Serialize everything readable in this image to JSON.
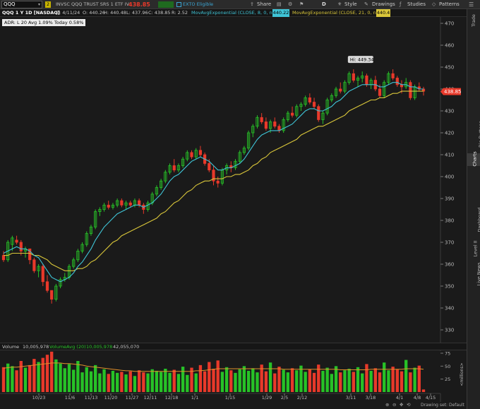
{
  "toolbar": {
    "symbol": "QQQ",
    "badge": "2",
    "security_name": "INVSC QQQ TRUST SRS 1 ETF IV",
    "last_price": "438.85",
    "change_pct": "",
    "ext_label": "EXTO Eligible",
    "share": "Share",
    "d_label": "D",
    "style": "Style",
    "drawings": "Drawings",
    "studies": "Studies",
    "patterns": "Patterns"
  },
  "infobar": {
    "title": "QQQ 1 Y 1D [NASDAQ]",
    "date": "D: 4/11/24",
    "open": "O: 440.26",
    "high": "H: 440.48",
    "low": "L: 437.96",
    "close": "C: 438.85",
    "range": "R: 2.52",
    "ma8_label": "MovAvgExponential (CLOSE, 8, 0, no)",
    "ma8_value": "440.22",
    "ma21_label": "MovAvgExponential (CLOSE, 21, 0, no)",
    "ma21_value": "440.4"
  },
  "adr": {
    "text": "ADR: L 20   Avg 1.09%   Today 0.58%"
  },
  "price_axis": {
    "ticks": [
      "470",
      "460",
      "450",
      "440",
      "430",
      "420",
      "410",
      "400",
      "390",
      "380",
      "370",
      "360",
      "350",
      "340",
      "330"
    ],
    "last_price_label": "438.85",
    "hi_label": "Hi: 449.34"
  },
  "volume": {
    "label": "Volume",
    "value": "10,005,978",
    "avg_label": "VolumeAvg (20)",
    "avg_value": "10,005,978",
    "third_value": "42,055,070",
    "axis_ticks": [
      "75",
      "50",
      "25"
    ],
    "axis_unit": "<millions>"
  },
  "date_axis": [
    "10/23",
    "11/6",
    "11/13",
    "11/20",
    "11/27",
    "12/11",
    "12/18",
    "1/1",
    "1/15",
    "1/29",
    "2/5",
    "2/12",
    "3/11",
    "3/18",
    "4/1",
    "4/8",
    "4/15"
  ],
  "sidebar": {
    "items": [
      "Trade",
      "Times And Sales",
      "Active Trader",
      "Big Buttons",
      "Charts",
      "Phase Scores",
      "Dashboard",
      "Level II",
      "Live News"
    ]
  },
  "bottom": {
    "drawing_set": "Drawing set: Default"
  },
  "colors": {
    "up": "#27c227",
    "down": "#e8392a",
    "ma8": "#3fc4d6",
    "ma21": "#d9c63a",
    "vol_avg": "#e0902a",
    "price_tag": "#e8392a"
  },
  "chart_data": {
    "type": "candlestick",
    "title": "QQQ 1 Y 1D [NASDAQ]",
    "ylim": [
      325,
      475
    ],
    "candles": [
      [
        364,
        366,
        361,
        362
      ],
      [
        362,
        371,
        361,
        370
      ],
      [
        369,
        373,
        366,
        372
      ],
      [
        371,
        373,
        369,
        370
      ],
      [
        370,
        371,
        364,
        366
      ],
      [
        366,
        368,
        363,
        367
      ],
      [
        367,
        367,
        360,
        362
      ],
      [
        362,
        363,
        356,
        357
      ],
      [
        357,
        360,
        354,
        359
      ],
      [
        359,
        360,
        350,
        352
      ],
      [
        352,
        355,
        347,
        348
      ],
      [
        348,
        348,
        342,
        344
      ],
      [
        344,
        351,
        343,
        350
      ],
      [
        350,
        354,
        349,
        353
      ],
      [
        353,
        356,
        352,
        354
      ],
      [
        354,
        360,
        353,
        359
      ],
      [
        359,
        363,
        358,
        362
      ],
      [
        362,
        367,
        361,
        366
      ],
      [
        366,
        370,
        365,
        369
      ],
      [
        369,
        375,
        368,
        374
      ],
      [
        374,
        378,
        373,
        377
      ],
      [
        377,
        385,
        376,
        384
      ],
      [
        384,
        386,
        382,
        385
      ],
      [
        385,
        388,
        384,
        387
      ],
      [
        387,
        389,
        385,
        386
      ],
      [
        386,
        388,
        385,
        387
      ],
      [
        387,
        390,
        386,
        389
      ],
      [
        389,
        390,
        386,
        387
      ],
      [
        387,
        389,
        385,
        388
      ],
      [
        388,
        389,
        386,
        387
      ],
      [
        387,
        390,
        386,
        389
      ],
      [
        389,
        390,
        386,
        387
      ],
      [
        387,
        388,
        383,
        385
      ],
      [
        385,
        389,
        384,
        388
      ],
      [
        388,
        393,
        387,
        392
      ],
      [
        392,
        396,
        391,
        395
      ],
      [
        395,
        399,
        394,
        398
      ],
      [
        398,
        403,
        397,
        402
      ],
      [
        402,
        406,
        401,
        405
      ],
      [
        405,
        408,
        402,
        403
      ],
      [
        403,
        406,
        402,
        405
      ],
      [
        405,
        409,
        404,
        408
      ],
      [
        408,
        412,
        407,
        411
      ],
      [
        411,
        412,
        408,
        409
      ],
      [
        409,
        413,
        408,
        412
      ],
      [
        412,
        414,
        409,
        410
      ],
      [
        410,
        411,
        405,
        406
      ],
      [
        406,
        408,
        402,
        403
      ],
      [
        403,
        405,
        396,
        398
      ],
      [
        398,
        400,
        395,
        397
      ],
      [
        397,
        404,
        396,
        403
      ],
      [
        403,
        406,
        401,
        405
      ],
      [
        405,
        407,
        402,
        404
      ],
      [
        404,
        408,
        403,
        407
      ],
      [
        407,
        412,
        406,
        411
      ],
      [
        411,
        414,
        410,
        413
      ],
      [
        413,
        421,
        412,
        420
      ],
      [
        420,
        424,
        418,
        423
      ],
      [
        423,
        428,
        422,
        427
      ],
      [
        427,
        429,
        424,
        425
      ],
      [
        425,
        427,
        421,
        422
      ],
      [
        422,
        426,
        420,
        425
      ],
      [
        425,
        427,
        422,
        423
      ],
      [
        423,
        424,
        420,
        421
      ],
      [
        421,
        427,
        420,
        426
      ],
      [
        426,
        430,
        425,
        429
      ],
      [
        429,
        432,
        427,
        428
      ],
      [
        428,
        433,
        427,
        432
      ],
      [
        432,
        434,
        430,
        433
      ],
      [
        433,
        437,
        432,
        436
      ],
      [
        436,
        438,
        433,
        434
      ],
      [
        434,
        436,
        431,
        432
      ],
      [
        432,
        433,
        425,
        426
      ],
      [
        426,
        430,
        424,
        429
      ],
      [
        429,
        436,
        428,
        435
      ],
      [
        435,
        438,
        434,
        437
      ],
      [
        437,
        441,
        436,
        440
      ],
      [
        440,
        443,
        438,
        439
      ],
      [
        439,
        444,
        438,
        443
      ],
      [
        443,
        448,
        442,
        447
      ],
      [
        447,
        449,
        443,
        444
      ],
      [
        444,
        446,
        441,
        445
      ],
      [
        445,
        448,
        443,
        446
      ],
      [
        446,
        447,
        441,
        442
      ],
      [
        442,
        445,
        440,
        444
      ],
      [
        444,
        446,
        439,
        440
      ],
      [
        440,
        442,
        436,
        437
      ],
      [
        437,
        444,
        436,
        443
      ],
      [
        443,
        448,
        442,
        447
      ],
      [
        447,
        449,
        444,
        445
      ],
      [
        445,
        446,
        441,
        442
      ],
      [
        442,
        444,
        438,
        441
      ],
      [
        441,
        445,
        440,
        443
      ],
      [
        443,
        444,
        435,
        436
      ],
      [
        436,
        442,
        435,
        441
      ],
      [
        441,
        443,
        439,
        440
      ],
      [
        440,
        441,
        437,
        439
      ]
    ],
    "ema8": [
      365,
      366,
      367,
      368,
      367,
      367,
      366,
      364,
      363,
      360,
      357,
      354,
      353,
      352,
      353,
      354,
      356,
      359,
      361,
      364,
      367,
      371,
      374,
      377,
      379,
      381,
      383,
      384,
      385,
      386,
      387,
      387,
      386,
      387,
      388,
      390,
      392,
      395,
      398,
      400,
      401,
      403,
      405,
      407,
      408,
      409,
      408,
      407,
      405,
      403,
      403,
      404,
      404,
      405,
      406,
      408,
      411,
      414,
      417,
      419,
      420,
      421,
      421,
      421,
      422,
      423,
      424,
      426,
      428,
      430,
      431,
      431,
      430,
      430,
      431,
      432,
      434,
      435,
      437,
      439,
      440,
      441,
      442,
      442,
      442,
      442,
      441,
      441,
      442,
      443,
      443,
      442,
      442,
      441,
      441,
      440,
      440
    ],
    "ema21": [
      364,
      364,
      365,
      365,
      365,
      365,
      365,
      364,
      364,
      363,
      362,
      360,
      359,
      358,
      357,
      357,
      357,
      358,
      358,
      359,
      361,
      362,
      364,
      366,
      368,
      370,
      371,
      373,
      374,
      375,
      376,
      377,
      378,
      379,
      380,
      381,
      383,
      384,
      386,
      388,
      389,
      391,
      393,
      394,
      396,
      397,
      398,
      398,
      399,
      399,
      399,
      400,
      400,
      401,
      401,
      402,
      403,
      405,
      406,
      408,
      409,
      411,
      412,
      413,
      414,
      415,
      416,
      417,
      419,
      420,
      421,
      422,
      423,
      423,
      424,
      425,
      426,
      427,
      428,
      430,
      431,
      432,
      433,
      434,
      435,
      435,
      436,
      436,
      437,
      438,
      438,
      439,
      439,
      439,
      439,
      439,
      439
    ],
    "volume": [
      48,
      55,
      50,
      42,
      60,
      47,
      52,
      64,
      58,
      66,
      72,
      78,
      63,
      55,
      46,
      54,
      43,
      60,
      38,
      48,
      40,
      52,
      36,
      44,
      35,
      41,
      37,
      39,
      34,
      40,
      31,
      42,
      38,
      36,
      44,
      41,
      39,
      45,
      37,
      43,
      35,
      49,
      33,
      47,
      36,
      52,
      40,
      58,
      45,
      61,
      39,
      48,
      42,
      37,
      44,
      50,
      41,
      46,
      38,
      53,
      40,
      57,
      36,
      49,
      43,
      38,
      46,
      42,
      51,
      39,
      44,
      37,
      53,
      41,
      47,
      35,
      50,
      38,
      42,
      45,
      39,
      48,
      36,
      54,
      41,
      46,
      38,
      57,
      42,
      49,
      44,
      40,
      62,
      38,
      47,
      51,
      5
    ],
    "volume_avg": [
      46,
      47,
      48,
      48,
      49,
      50,
      51,
      52,
      53,
      54,
      55,
      56,
      56,
      56,
      55,
      55,
      54,
      53,
      52,
      50,
      49,
      48,
      47,
      46,
      45,
      44,
      43,
      42,
      41,
      41,
      40,
      40,
      40,
      40,
      40,
      40,
      40,
      40,
      40,
      40,
      40,
      40,
      40,
      40,
      41,
      41,
      42,
      43,
      44,
      45,
      45,
      45,
      45,
      45,
      45,
      45,
      45,
      45,
      45,
      45,
      45,
      45,
      45,
      45,
      44,
      44,
      44,
      44,
      44,
      44,
      44,
      44,
      44,
      44,
      44,
      44,
      44,
      43,
      43,
      43,
      43,
      43,
      43,
      43,
      44,
      44,
      44,
      44,
      44,
      44,
      44,
      44,
      45,
      45,
      45,
      45,
      44
    ]
  }
}
